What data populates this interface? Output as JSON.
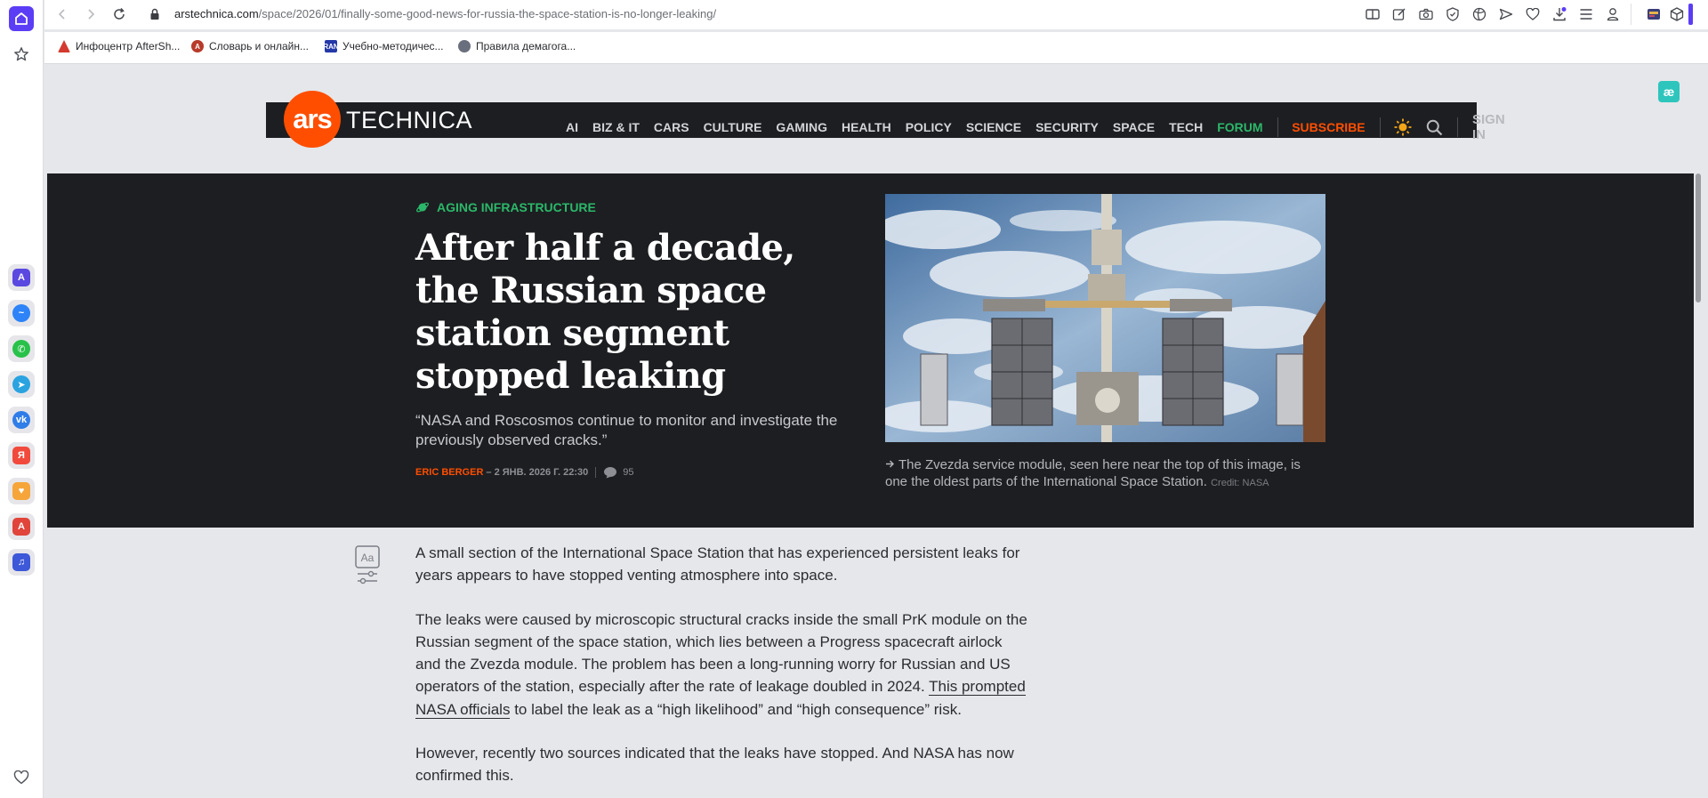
{
  "browser": {
    "url_host": "arstechnica.com",
    "url_path": "/space/2026/01/finally-some-good-news-for-russia-the-space-station-is-no-longer-leaking/",
    "bookmarks": [
      {
        "label": "Инфоцентр AfterSh..."
      },
      {
        "label": "Словарь и онлайн..."
      },
      {
        "label": "Учебно-методичес..."
      },
      {
        "label": "Правила демагога..."
      }
    ],
    "side_apps": [
      "aria-icon",
      "messenger-icon",
      "whatsapp-icon",
      "telegram-icon",
      "vk-icon",
      "yandex-icon",
      "pinboard-icon",
      "translate-icon",
      "music-icon"
    ],
    "ext_badge": "æ"
  },
  "site": {
    "logo_ars": "ars",
    "logo_technica": "TECHNICA",
    "nav": [
      "AI",
      "BIZ & IT",
      "CARS",
      "CULTURE",
      "GAMING",
      "HEALTH",
      "POLICY",
      "SCIENCE",
      "SECURITY",
      "SPACE",
      "TECH"
    ],
    "forum": "FORUM",
    "subscribe": "SUBSCRIBE",
    "sign_in": "SIGN IN",
    "accent": "#ff4e00",
    "green": "#2bb86a"
  },
  "article": {
    "category": "AGING INFRASTRUCTURE",
    "title": "After half a decade, the Russian space station segment stopped leaking",
    "dek": "“NASA and Roscosmos continue to monitor and investigate the previously observed cracks.”",
    "author": "ERIC BERGER",
    "date": "– 2 ЯНВ. 2026 Г. 22:30",
    "comments": "95",
    "caption": "The Zvezda service module, seen here near the top of this image, is one the oldest parts of the International Space Station.",
    "caption_credit": "Credit: NASA",
    "p1": "A small section of the International Space Station that has experienced persistent leaks for years appears to have stopped venting atmosphere into space.",
    "p2_a": "The leaks were caused by microscopic structural cracks inside the small PrK module on the Russian segment of the space station, which lies between a Progress spacecraft airlock and the Zvezda module. The problem has been a long-running worry for Russian and US operators of the station, especially after the rate of leakage doubled in 2024. ",
    "p2_link": "This prompted NASA officials",
    "p2_b": " to label the leak as a “high likelihood” and “high consequence” risk.",
    "p3": "However, recently two sources indicated that the leaks have stopped. And NASA has now confirmed this."
  }
}
